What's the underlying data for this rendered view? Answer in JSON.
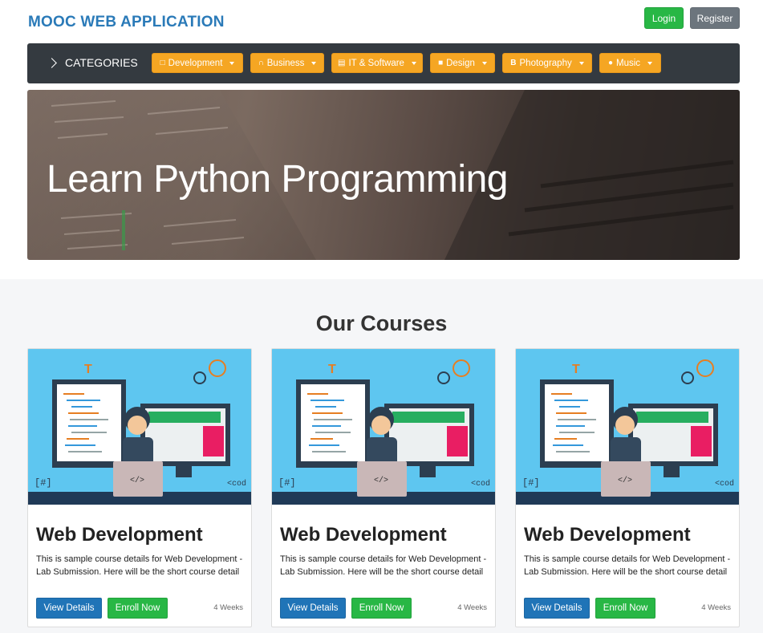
{
  "header": {
    "brand": "MOOC WEB APPLICATION",
    "login_label": "Login",
    "register_label": "Register"
  },
  "categories": {
    "label": "CATEGORIES",
    "items": [
      {
        "icon": "laptop-icon",
        "label": "Development"
      },
      {
        "icon": "magnet-icon",
        "label": "Business"
      },
      {
        "icon": "keyboard-icon",
        "label": "IT & Software"
      },
      {
        "icon": "square-icon",
        "label": "Design"
      },
      {
        "icon": "bold-b-icon",
        "label": "Photography"
      },
      {
        "icon": "apple-icon",
        "label": "Music"
      }
    ]
  },
  "hero": {
    "title": "Learn Python Programming"
  },
  "courses": {
    "title": "Our Courses",
    "items": [
      {
        "title": "Web Development",
        "description": "This is sample course details for Web Development - Lab Submission. Here will be the short course detail",
        "view_label": "View Details",
        "enroll_label": "Enroll Now",
        "duration": "4 Weeks"
      },
      {
        "title": "Web Development",
        "description": "This is sample course details for Web Development - Lab Submission. Here will be the short course detail",
        "view_label": "View Details",
        "enroll_label": "Enroll Now",
        "duration": "4 Weeks"
      },
      {
        "title": "Web Development",
        "description": "This is sample course details for Web Development - Lab Submission. Here will be the short course detail",
        "view_label": "View Details",
        "enroll_label": "Enroll Now",
        "duration": "4 Weeks"
      }
    ]
  },
  "colors": {
    "brand": "#2a7ab8",
    "category_button": "#f5a623",
    "primary": "#2074b7",
    "success": "#28b745",
    "secondary": "#6c757d",
    "navbar": "#343a40"
  }
}
